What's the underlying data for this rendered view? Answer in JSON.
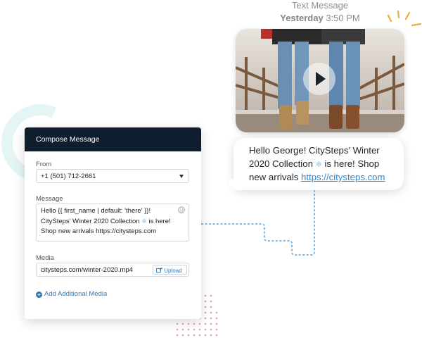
{
  "sms_preview": {
    "label": "Text Message",
    "day": "Yesterday",
    "time": "3:50 PM",
    "text_part1": "Hello George! CitySteps’ Winter 2020 Collection",
    "snow_glyph": "❄",
    "text_part2": " is here! Shop new arrivals ",
    "link": "https://citysteps.com"
  },
  "compose": {
    "title": "Compose Message",
    "from_label": "From",
    "from_value": "+1 (501) 712-2661",
    "message_label": "Message",
    "message_part1": "Hello {{ first_name | default: 'there' }}! CitySteps’ Winter 2020 Collection",
    "snow_glyph": "❄",
    "message_part2": " is here! Shop new arrivals https://citysteps.com",
    "media_label": "Media",
    "media_value": "citysteps.com/winter-2020.mp4",
    "upload_label": "Upload",
    "add_media_label": "Add Additional Media"
  },
  "icons": {
    "play": "play-icon",
    "emoji": "emoji-icon",
    "upload": "upload-icon",
    "add": "plus-circle-icon",
    "dropdown": "chevron-down-icon"
  },
  "colors": {
    "header_bg": "#0f1e2e",
    "link": "#2d86c9",
    "accent": "#2f77b5",
    "sparkle": "#f0a93c"
  }
}
